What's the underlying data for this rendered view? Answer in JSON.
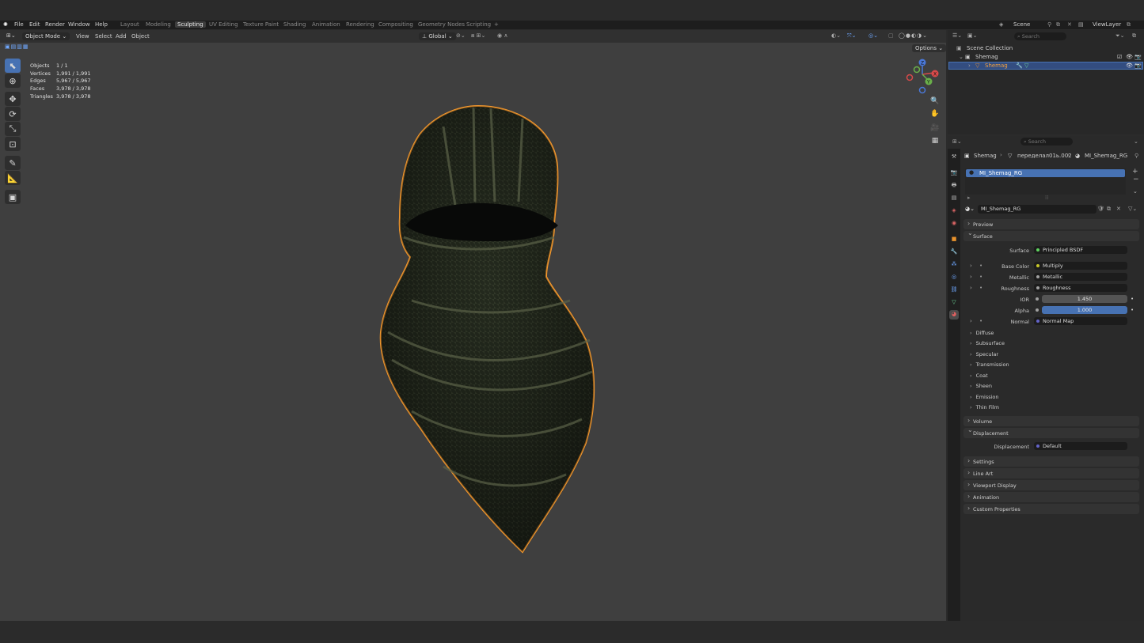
{
  "menu": {
    "items": [
      "File",
      "Edit",
      "Render",
      "Window",
      "Help"
    ]
  },
  "workspaces": [
    "Layout",
    "Modeling",
    "Sculpting",
    "UV Editing",
    "Texture Paint",
    "Shading",
    "Animation",
    "Rendering",
    "Compositing",
    "Geometry Nodes",
    "Scripting"
  ],
  "active_workspace": "Sculpting",
  "scene": {
    "name": "Scene",
    "view_layer": "ViewLayer"
  },
  "viewport": {
    "mode": "Object Mode",
    "menus": [
      "View",
      "Select",
      "Add",
      "Object"
    ],
    "transform": "Global",
    "options": "Options",
    "stats": [
      {
        "label": "Objects",
        "value": "1 / 1"
      },
      {
        "label": "Vertices",
        "value": "1,991 / 1,991"
      },
      {
        "label": "Edges",
        "value": "5,967 / 5,967"
      },
      {
        "label": "Faces",
        "value": "3,978 / 3,978"
      },
      {
        "label": "Triangles",
        "value": "3,978 / 3,978"
      }
    ],
    "gizmo": {
      "x": "X",
      "y": "Y",
      "z": "Z"
    }
  },
  "outliner": {
    "search_placeholder": "Search",
    "scene_collection": "Scene Collection",
    "collection": "Shemag",
    "object": "Shemag"
  },
  "properties": {
    "search_placeholder": "Search",
    "breadcrumb": {
      "object": "Shemag",
      "mesh": "переделал01ь.002",
      "material": "MI_Shemag_RG"
    },
    "slot_name": "MI_Shemag_RG",
    "material_name": "MI_Shemag_RG",
    "panels": {
      "preview": "Preview",
      "surface": "Surface",
      "volume": "Volume",
      "displacement": "Displacement",
      "settings": "Settings",
      "line_art": "Line Art",
      "viewport_display": "Viewport Display",
      "animation": "Animation",
      "custom_properties": "Custom Properties"
    },
    "surface": {
      "surface_label": "Surface",
      "surface_value": "Principled BSDF",
      "base_color_label": "Base Color",
      "base_color_value": "Multiply",
      "metallic_label": "Metallic",
      "metallic_value": "Metallic",
      "roughness_label": "Roughness",
      "roughness_value": "Roughness",
      "ior_label": "IOR",
      "ior_value": "1.450",
      "alpha_label": "Alpha",
      "alpha_value": "1.000",
      "normal_label": "Normal",
      "normal_value": "Normal Map"
    },
    "subpanels": [
      "Diffuse",
      "Subsurface",
      "Specular",
      "Transmission",
      "Coat",
      "Sheen",
      "Emission",
      "Thin Film"
    ],
    "displacement": {
      "label": "Displacement",
      "value": "Default"
    }
  },
  "colors": {
    "accent": "#4772b3",
    "selection_outline": "#e8922c",
    "fabric": "#3a4031"
  }
}
